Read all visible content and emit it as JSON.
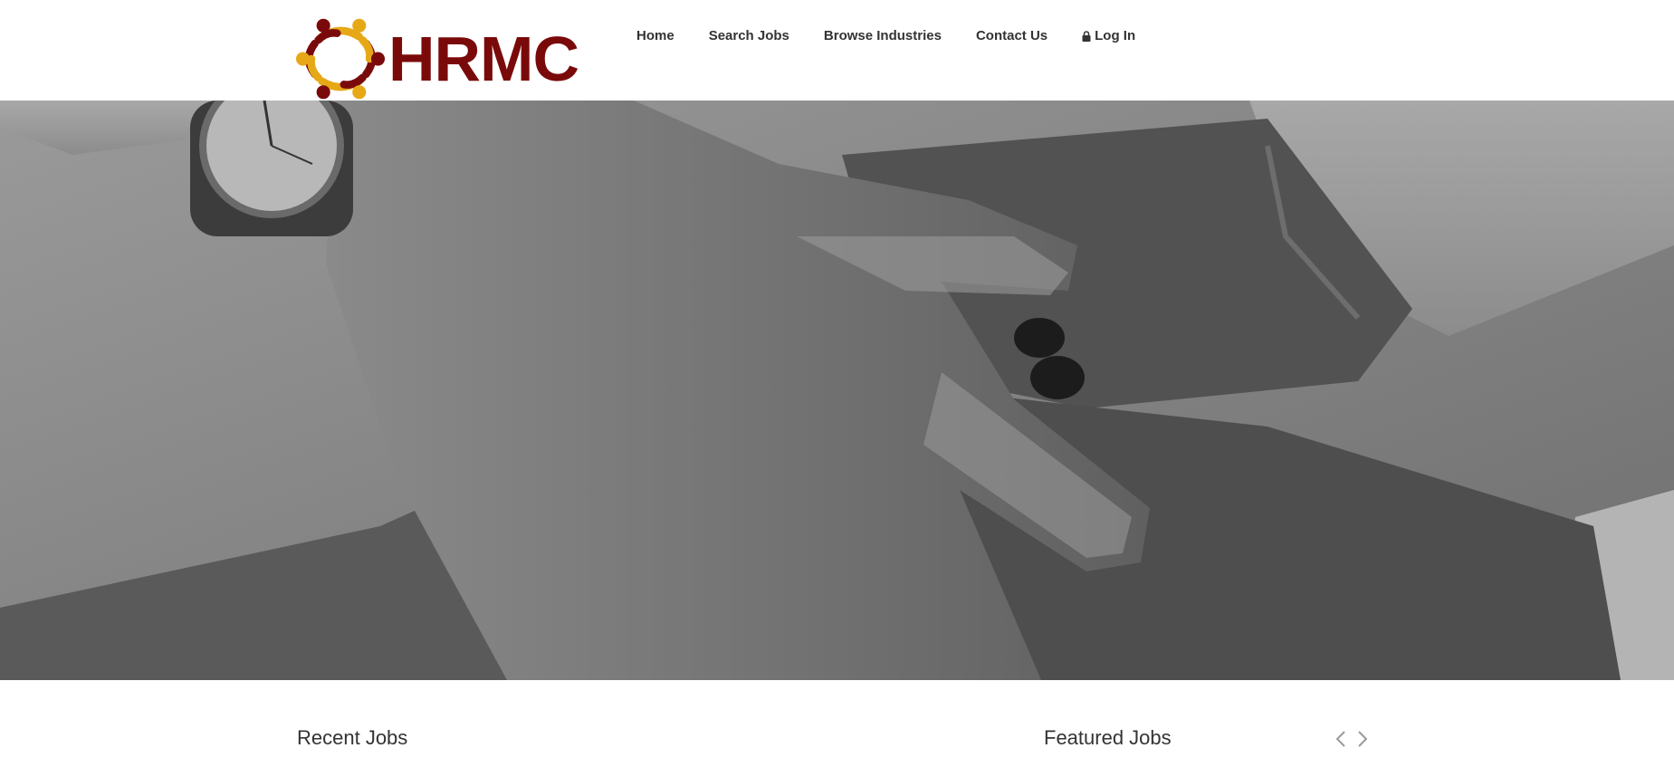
{
  "brand": {
    "name": "HRMC",
    "colors": {
      "primary": "#7a0a0a",
      "accent": "#e6a817"
    }
  },
  "nav": {
    "items": [
      {
        "label": "Home"
      },
      {
        "label": "Search Jobs"
      },
      {
        "label": "Browse Industries"
      },
      {
        "label": "Contact Us"
      },
      {
        "label": "Log In",
        "icon": "lock-icon"
      }
    ]
  },
  "hero": {
    "image": "grayscale photo of stacked hands"
  },
  "sections": {
    "recent_jobs_title": "Recent Jobs",
    "featured_jobs_title": "Featured Jobs",
    "carousel": {
      "prev_icon": "chevron-left-icon",
      "next_icon": "chevron-right-icon"
    }
  }
}
